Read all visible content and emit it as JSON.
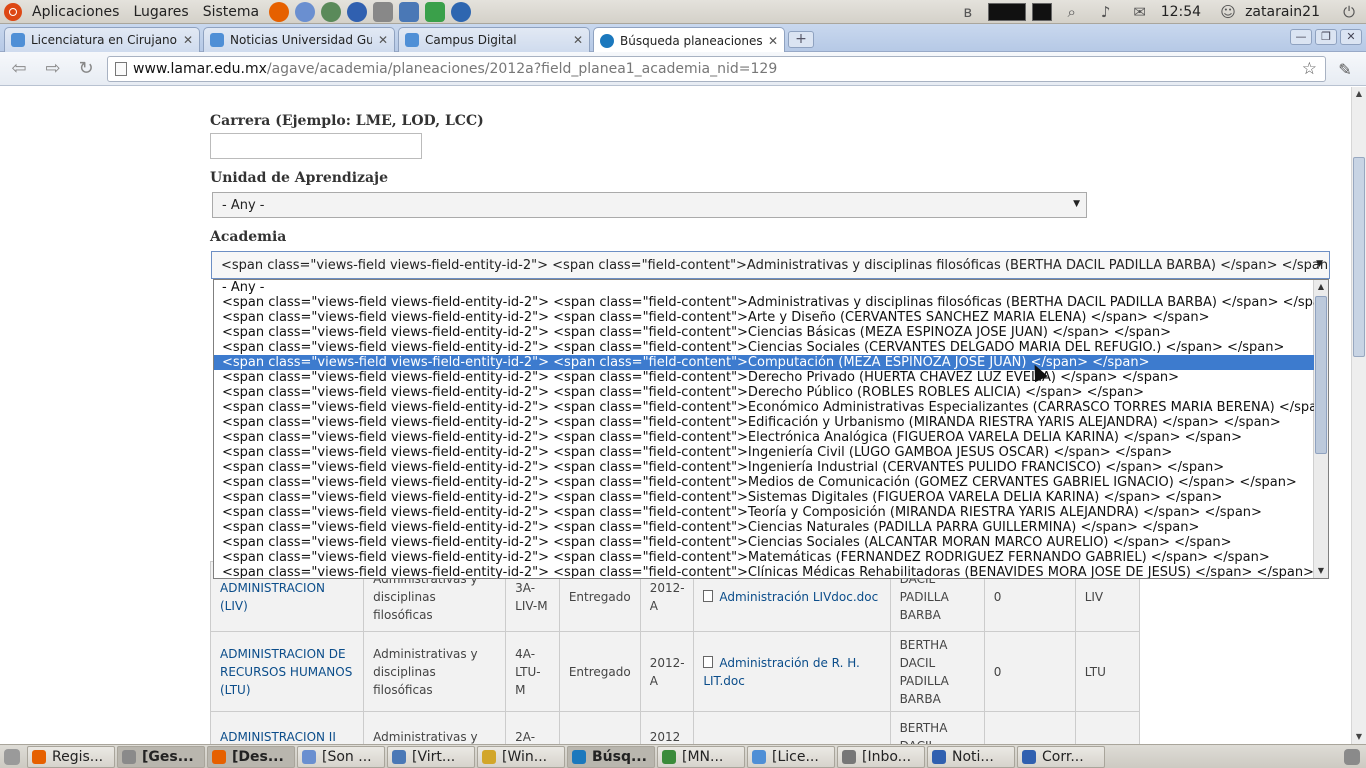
{
  "gnome_panel": {
    "menus": [
      "Aplicaciones",
      "Lugares",
      "Sistema"
    ],
    "clock": "12:54",
    "user": "zatarain21"
  },
  "browser": {
    "tabs": [
      {
        "title": "Licenciatura en Cirujano D",
        "favicon_color": "#4f8fd6"
      },
      {
        "title": "Noticias Universidad Guad",
        "favicon_color": "#4f8fd6"
      },
      {
        "title": "Campus Digital",
        "favicon_color": "#4f8fd6"
      },
      {
        "title": "Búsqueda planeaciones pc",
        "favicon_color": "#1b78bd"
      }
    ],
    "url_host": "www.lamar.edu.mx",
    "url_path": "/agave/academia/planeaciones/2012a?field_planea1_academia_nid=129"
  },
  "form": {
    "carrera_label": "Carrera (Ejemplo: LME, LOD, LCC)",
    "carrera_value": "",
    "unidad_label": "Unidad de Aprendizaje",
    "unidad_value": "- Any -",
    "academia_label": "Academia",
    "academia_value": "<span class=\"views-field views-field-entity-id-2\"> <span class=\"field-content\">Administrativas y disciplinas filosóficas (BERTHA DACIL PADILLA BARBA) </span> </span>"
  },
  "dropdown_options": [
    "- Any -",
    "<span class=\"views-field views-field-entity-id-2\"> <span class=\"field-content\">Administrativas y disciplinas filosóficas (BERTHA DACIL PADILLA BARBA) </span> </span>",
    "<span class=\"views-field views-field-entity-id-2\"> <span class=\"field-content\">Arte y Diseño (CERVANTES SÁNCHEZ MARIA ELENA) </span> </span>",
    "<span class=\"views-field views-field-entity-id-2\"> <span class=\"field-content\">Ciencias Básicas (MEZA ESPINOZA JOSE JUAN) </span> </span>",
    "<span class=\"views-field views-field-entity-id-2\"> <span class=\"field-content\">Ciencias Sociales (CERVANTES DELGADO MARIA DEL REFUGIO.) </span> </span>",
    "<span class=\"views-field views-field-entity-id-2\"> <span class=\"field-content\">Computación (MEZA ESPINOZA JOSE JUAN) </span> </span>",
    "<span class=\"views-field views-field-entity-id-2\"> <span class=\"field-content\">Derecho Privado (HUERTA CHAVEZ LUZ EVELIA) </span> </span>",
    "<span class=\"views-field views-field-entity-id-2\"> <span class=\"field-content\">Derecho Público (ROBLES ROBLES ALICIA) </span> </span>",
    "<span class=\"views-field views-field-entity-id-2\"> <span class=\"field-content\">Económico Administrativas Especializantes (CARRASCO TORRES MARIA BERENA) </span> </span>",
    "<span class=\"views-field views-field-entity-id-2\"> <span class=\"field-content\">Edificación y Urbanismo (MIRANDA RIESTRA YARIS ALEJANDRA) </span> </span>",
    "<span class=\"views-field views-field-entity-id-2\"> <span class=\"field-content\">Electrónica Analógica (FIGUEROA VARELA DELIA KARINA) </span> </span>",
    "<span class=\"views-field views-field-entity-id-2\"> <span class=\"field-content\">Ingeniería Civil (LUGO GAMBOA JESÚS OSCAR) </span> </span>",
    "<span class=\"views-field views-field-entity-id-2\"> <span class=\"field-content\">Ingeniería Industrial (CERVANTES PULIDO FRANCISCO) </span> </span>",
    "<span class=\"views-field views-field-entity-id-2\"> <span class=\"field-content\">Medios de Comunicación (GOMEZ CERVANTES GABRIEL IGNACIO) </span> </span>",
    "<span class=\"views-field views-field-entity-id-2\"> <span class=\"field-content\">Sistemas Digitales (FIGUEROA VARELA DELIA KARINA) </span> </span>",
    "<span class=\"views-field views-field-entity-id-2\"> <span class=\"field-content\">Teoría y Composición (MIRANDA RIESTRA YARIS ALEJANDRA) </span> </span>",
    "<span class=\"views-field views-field-entity-id-2\"> <span class=\"field-content\">Ciencias Naturales (PADILLA PARRA GUILLERMINA) </span> </span>",
    "<span class=\"views-field views-field-entity-id-2\"> <span class=\"field-content\">Ciencias Sociales (ALCANTAR MORAN MARCO AURELIO) </span> </span>",
    "<span class=\"views-field views-field-entity-id-2\"> <span class=\"field-content\">Matemáticas (FERNANDEZ RODRIGUEZ FERNANDO GABRIEL) </span> </span>",
    "<span class=\"views-field views-field-entity-id-2\"> <span class=\"field-content\">Clínicas Médicas Rehabilitadoras (BENAVIDES MORA JOSÉ DE JESÚS) </span> </span>"
  ],
  "selected_option_index": 5,
  "table_rows": [
    {
      "subject": "ADMINISTRACION (LIV)",
      "academia": "Administrativas y disciplinas filosóficas",
      "group": "3A-LIV-M",
      "status": "Entregado",
      "period": "2012-A",
      "file": "Administración LIVdoc.doc",
      "teacher": "DACIL PADILLA BARBA",
      "count": "0",
      "code": "LIV"
    },
    {
      "subject": "ADMINISTRACION DE RECURSOS HUMANOS (LTU)",
      "academia": "Administrativas y disciplinas filosóficas",
      "group": "4A-LTU-M",
      "status": "Entregado",
      "period": "2012-A",
      "file": "Administración de R. H. LIT.doc",
      "teacher": "BERTHA DACIL PADILLA BARBA",
      "count": "0",
      "code": "LTU"
    },
    {
      "subject": "ADMINISTRACION II",
      "academia": "Administrativas y",
      "group": "2A-",
      "status": "",
      "period": "2012",
      "file": "",
      "teacher": "BERTHA DACIL",
      "count": "",
      "code": ""
    }
  ],
  "taskbar": [
    {
      "label": "Regis...",
      "color": "#e66000"
    },
    {
      "label": "[Ges...",
      "color": "#8a8a8a",
      "active": true
    },
    {
      "label": "[Des...",
      "color": "#e66000",
      "active": true
    },
    {
      "label": "[Son ...",
      "color": "#6a8fd0"
    },
    {
      "label": "[Virt...",
      "color": "#4a78b6"
    },
    {
      "label": "[Win...",
      "color": "#d2a62a"
    },
    {
      "label": "Búsq...",
      "color": "#1b78bd",
      "active": true
    },
    {
      "label": "[MN...",
      "color": "#3a8b3a"
    },
    {
      "label": "[Lice...",
      "color": "#4f8fd6"
    },
    {
      "label": "[Inbo...",
      "color": "#777"
    },
    {
      "label": "Noti...",
      "color": "#3060b0"
    },
    {
      "label": "Corr...",
      "color": "#3060b0"
    }
  ]
}
